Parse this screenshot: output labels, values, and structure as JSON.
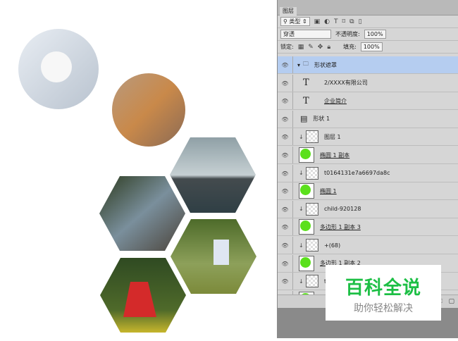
{
  "panel": {
    "tab": "图层",
    "filter_kind": "类型",
    "blend_mode": "穿透",
    "opacity_label": "不透明度:",
    "opacity_value": "100%",
    "lock_label": "锁定:",
    "fill_label": "填充:",
    "fill_value": "100%",
    "layers": [
      {
        "name": "形状遮罩",
        "type": "group",
        "selected": true
      },
      {
        "name": "2/XXXX有限公司",
        "type": "text"
      },
      {
        "name": "企业简介",
        "type": "text"
      },
      {
        "name": "形状 1",
        "type": "shape"
      },
      {
        "name": "图层 1",
        "type": "clipped"
      },
      {
        "name": "椭圆 1 副本",
        "type": "ellipse"
      },
      {
        "name": "t0164131e7a6697da8c",
        "type": "clipped"
      },
      {
        "name": "椭圆 1",
        "type": "ellipse"
      },
      {
        "name": "child-920128",
        "type": "clipped"
      },
      {
        "name": "多边形 1 副本 3",
        "type": "ellipse"
      },
      {
        "name": "+(68)",
        "type": "clipped"
      },
      {
        "name": "多边形 1 副本 2",
        "type": "ellipse"
      },
      {
        "name": "t",
        "type": "clipped"
      },
      {
        "name": "多",
        "type": "ellipse"
      }
    ]
  },
  "watermark": {
    "title": "百科全说",
    "subtitle": "助你轻松解决",
    "color": "#1dbf45"
  }
}
